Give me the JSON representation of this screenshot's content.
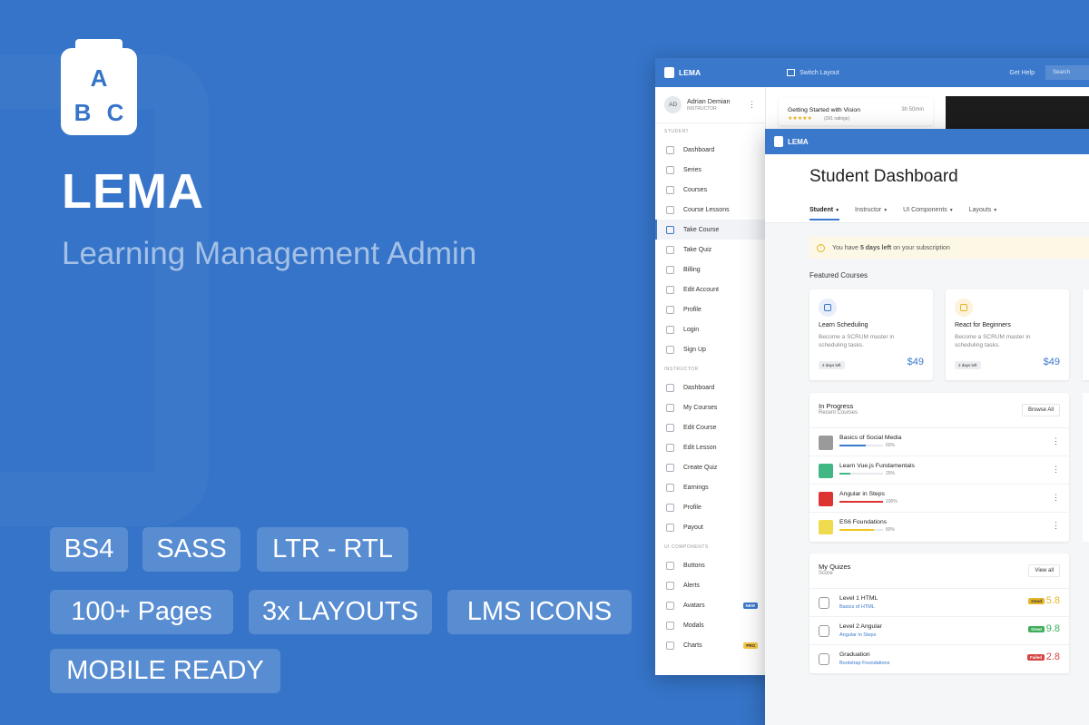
{
  "hero": {
    "logo_letters": [
      "A",
      "B",
      "C"
    ],
    "brand": "LEMA",
    "tagline": "Learning Management Admin",
    "features": [
      "BS4",
      "SASS",
      "LTR - RTL",
      "100+ Pages",
      "3x LAYOUTS",
      "LMS ICONS",
      "MOBILE READY"
    ]
  },
  "back_window": {
    "topbar": {
      "logo": "LEMA",
      "switch_layout": "Switch Layout",
      "get_help": "Get Help",
      "search": "Search"
    },
    "user": {
      "initials": "AD",
      "name": "Adrian Demian",
      "role": "INSTRUCTOR"
    },
    "course_card": {
      "title": "Getting Started with Vision",
      "duration": "3h 50min",
      "rating_text": "(391 ratings)",
      "stars": 4.5
    },
    "sections": [
      {
        "label": "STUDENT",
        "items": [
          "Dashboard",
          "Series",
          "Courses",
          "Course Lessons",
          "Take Course",
          "Take Quiz",
          "Billing",
          "Edit Account",
          "Profile",
          "Login",
          "Sign Up"
        ]
      },
      {
        "label": "INSTRUCTOR",
        "items": [
          "Dashboard",
          "My Courses",
          "Edit Course",
          "Edit Lesson",
          "Create Quiz",
          "Earnings",
          "Profile",
          "Payout"
        ]
      },
      {
        "label": "UI COMPONENTS",
        "items": [
          "Buttons",
          "Alerts",
          "Avatars",
          "Modals",
          "Charts"
        ]
      }
    ],
    "active_item": "Take Course",
    "badges": {
      "Avatars": "NEW",
      "Charts": "PRO"
    }
  },
  "front_window": {
    "logo": "LEMA",
    "title": "Student Dashboard",
    "tabs": [
      "Student",
      "Instructor",
      "UI Components",
      "Layouts"
    ],
    "active_tab": "Student",
    "alert": {
      "prefix": "You have ",
      "bold": "5 days left",
      "suffix": " on your subscription"
    },
    "featured_heading": "Featured Courses",
    "featured": [
      {
        "title": "Learn Scheduling",
        "desc": "Become a SCRUM master in scheduling tasks.",
        "days_left": "2 days left",
        "price": "$49",
        "icon_bg": "#e8eefa",
        "icon_color": "#3a78cc"
      },
      {
        "title": "React for Beginners",
        "desc": "Become a SCRUM master in scheduling tasks.",
        "days_left": "2 days left",
        "price": "$49",
        "icon_bg": "#fdf3dc",
        "icon_color": "#e4b52c"
      }
    ],
    "in_progress": {
      "title": "In Progress",
      "subtitle": "Recent Courses",
      "button": "Browse All",
      "items": [
        {
          "title": "Basics of Social Media",
          "progress": 60,
          "label": "60%",
          "color": "#3a78cc",
          "thumb": "#9a9a9a"
        },
        {
          "title": "Learn Vue.js Fundamentals",
          "progress": 25,
          "label": "25%",
          "color": "#41b883",
          "thumb": "#41b883"
        },
        {
          "title": "Angular in Steps",
          "progress": 100,
          "label": "100%",
          "color": "#dd3333",
          "thumb": "#dd3333"
        },
        {
          "title": "ES6 Foundations",
          "progress": 80,
          "label": "80%",
          "color": "#f0c419",
          "thumb": "#f0db4f"
        }
      ]
    },
    "quizzes": {
      "title": "My Quizes",
      "subtitle": "Score",
      "button": "View all",
      "items": [
        {
          "title": "Level 1 HTML",
          "course": "Basics of HTML",
          "badge": "Good",
          "score": "5.8",
          "color": "#e4b52c"
        },
        {
          "title": "Level 2 Angular",
          "course": "Angular in Steps",
          "badge": "Great",
          "score": "9.8",
          "color": "#3fae5a"
        },
        {
          "title": "Graduation",
          "course": "Bootstrap Foundations",
          "badge": "Failed",
          "score": "2.8",
          "color": "#d64545"
        }
      ]
    }
  }
}
